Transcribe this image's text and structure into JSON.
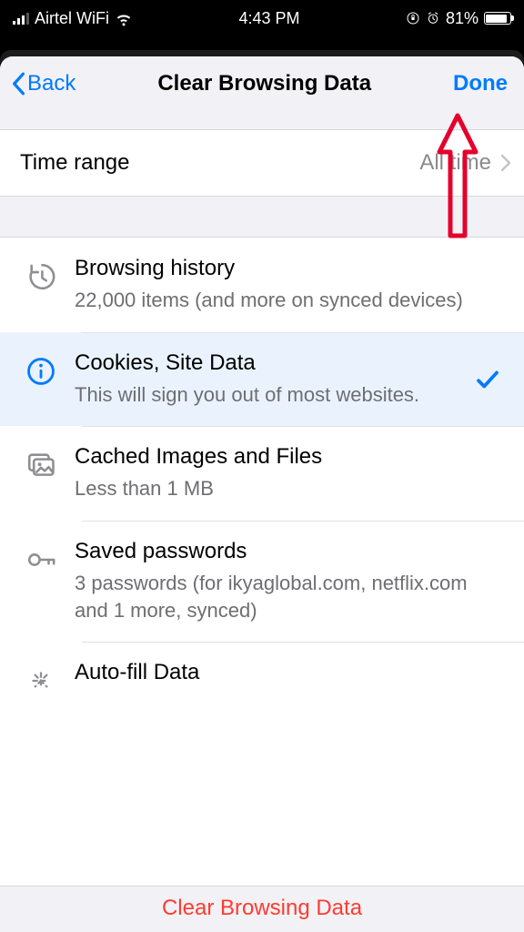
{
  "status": {
    "carrier": "Airtel WiFi",
    "time": "4:43 PM",
    "battery_pct": "81%",
    "battery_fill_pct": 81
  },
  "nav": {
    "back": "Back",
    "title": "Clear Browsing Data",
    "done": "Done"
  },
  "range": {
    "label": "Time range",
    "value": "All time"
  },
  "rows": {
    "history": {
      "title": "Browsing history",
      "sub": "22,000 items (and more on synced devices)"
    },
    "cookies": {
      "title": "Cookies, Site Data",
      "sub": "This will sign you out of most websites."
    },
    "cache": {
      "title": "Cached Images and Files",
      "sub": "Less than 1 MB"
    },
    "passwords": {
      "title": "Saved passwords",
      "sub": "3 passwords (for ikyaglobal.com, netflix.com and 1 more, synced)"
    },
    "autofill": {
      "title": "Auto-fill Data"
    }
  },
  "action": {
    "clear": "Clear Browsing Data"
  },
  "colors": {
    "accent": "#007aff",
    "destructive": "#ff3b30"
  }
}
